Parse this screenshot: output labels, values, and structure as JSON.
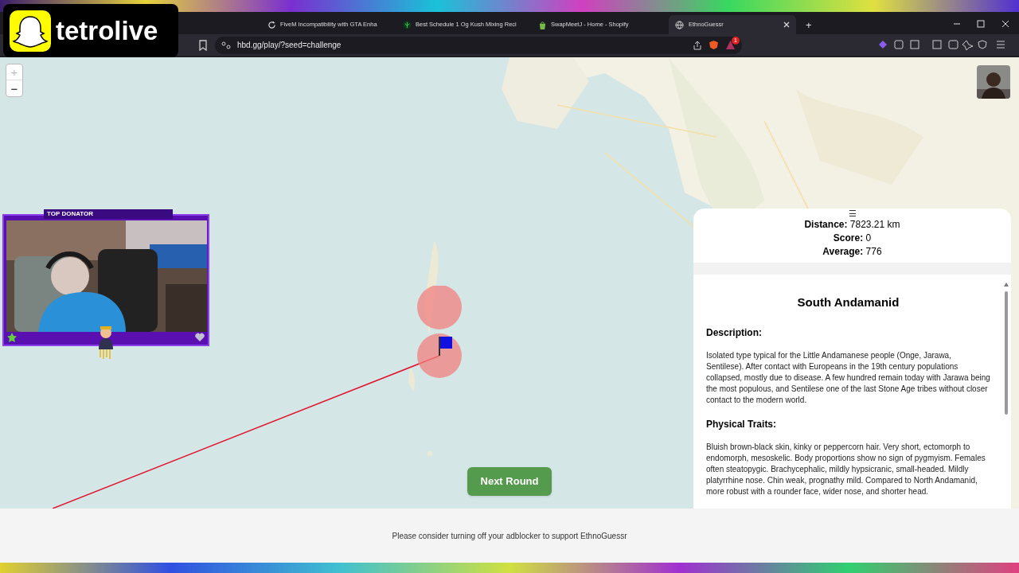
{
  "browser": {
    "tabs": [
      {
        "title": "FiveM Incompatibility with GTA Enha",
        "selected": false,
        "kind": "cycle"
      },
      {
        "title": "Best Schedule 1 Og Kush Mixing Reci",
        "selected": false,
        "kind": "leaf"
      },
      {
        "title": "SwapMeetJ - Home - Shopify",
        "selected": false,
        "kind": "bag"
      },
      {
        "title": "EthnoGuessr",
        "selected": true,
        "kind": "globe"
      }
    ],
    "new_tab": "+",
    "url": "hbd.gg/play/?seed=challenge",
    "extension_badge": "1"
  },
  "overlay": {
    "channel": "tetrolive",
    "webcam_banner": "TOP DONATOR"
  },
  "map": {
    "zoom_in": "+",
    "zoom_out": "−"
  },
  "result": {
    "menu": "☰",
    "stats": [
      "**Distance:** 7823.21 km",
      "**Score:** 0",
      "**Average:** 776"
    ],
    "title": "South Andamanid",
    "sections": [
      {
        "heading": "Description:",
        "text": "Isolated type typical for the Little Andamanese people (Onge, Jarawa, Sentilese). After contact with Europeans in the 19th century populations collapsed, mostly due to disease. A few hundred remain today with Jarawa being the most populous, and Sentilese one of the last Stone Age tribes without closer contact to the modern world."
      },
      {
        "heading": "Physical Traits:",
        "text": "Bluish brown-black skin, kinky or peppercorn hair. Very short, ectomorph to endomorph, mesoskelic. Body proportions show no sign of pygmyism. Females often steatopygic. Brachycephalic, mildly hypsicranic, small-headed. Mildly platyrrhine nose. Chin weak, prognathy mild. Compared to North Andamanid, more robust with a rounder face, wider nose, and shorter head."
      }
    ]
  },
  "next_round": "Next Round",
  "footer": "Please consider turning off your adblocker to support EthnoGuessr"
}
